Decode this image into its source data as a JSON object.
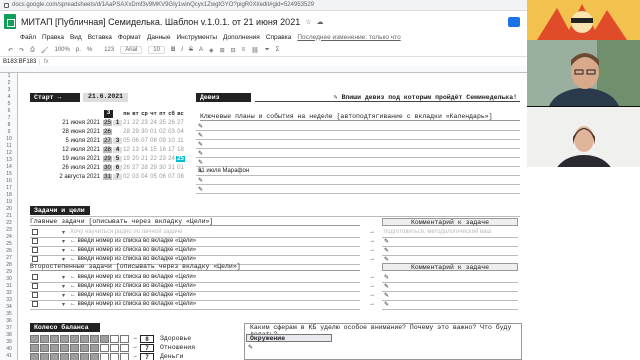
{
  "browser": {
    "url": "docs.google.com/spreadsheets/d/1AaPSAXxDmf3v9MKV9GIy1winQcyx1ZwgtGYO?pigR0Xl/edit#gid=524953529"
  },
  "sheet": {
    "title": "МИТАП [Публичная] Семиделька. Шаблон v.1.0.1. от 21 июня 2021",
    "menu": [
      "Файл",
      "Правка",
      "Вид",
      "Вставка",
      "Формат",
      "Данные",
      "Инструменты",
      "Дополнения",
      "Справка"
    ],
    "last_edit": "Последнее изменение: только что",
    "toolbar": {
      "zoom": "100%",
      "currency": "р.",
      "pct": "%",
      ".0": ".0",
      ".00": ".00",
      "fmt": "123",
      "font": "Arial",
      "size": "10"
    },
    "cell_ref": "B183:BF183"
  },
  "planner": {
    "start_label": "Старт →",
    "start_date": "21.6.2021",
    "motto_label": "Девиз",
    "motto_text": "✎ Впиши девиз под которым пройдёт Семинеделька!",
    "week_num": "3",
    "days": [
      "пн",
      "вт",
      "ср",
      "чт",
      "пт",
      "сб",
      "вс"
    ],
    "weeks": [
      {
        "date": "21 июня 2021",
        "num": "25",
        "mark": "1",
        "days": [
          "21",
          "22",
          "23",
          "24",
          "25",
          "26",
          "27"
        ]
      },
      {
        "date": "28 июня 2021",
        "num": "26",
        "mark": "",
        "days": [
          "28",
          "29",
          "30",
          "01",
          "02",
          "03",
          "04"
        ]
      },
      {
        "date": "5 июля 2021",
        "num": "27",
        "mark": "3",
        "days": [
          "05",
          "06",
          "07",
          "08",
          "09",
          "10",
          "11"
        ]
      },
      {
        "date": "12 июля 2021",
        "num": "28",
        "mark": "4",
        "days": [
          "12",
          "13",
          "14",
          "15",
          "16",
          "17",
          "18"
        ]
      },
      {
        "date": "19 июля 2021",
        "num": "29",
        "mark": "5",
        "days": [
          "19",
          "20",
          "21",
          "22",
          "23",
          "24",
          "25"
        ]
      },
      {
        "date": "26 июля 2021",
        "num": "30",
        "mark": "6",
        "days": [
          "26",
          "27",
          "28",
          "29",
          "30",
          "31",
          "01"
        ]
      },
      {
        "date": "2 августа 2021",
        "num": "31",
        "mark": "7",
        "days": [
          "02",
          "03",
          "04",
          "05",
          "06",
          "07",
          "08"
        ]
      }
    ],
    "events_header": "Ключевые планы и события на неделе [автоподтягивание с вкладки «Календарь»]",
    "event_note": "31 июля Марафон",
    "goals_block": "Задачи и цели",
    "main_tasks": "Главные задачи [описывать через вкладку «Цели»]",
    "comment": "Комментарий к задаче",
    "sub_tasks": "Второстепенные задачи [описывать через вкладку «Цели»]",
    "hint": "← введи номер из списка во вкладке «Цели»",
    "ghost_hint": "Хочу научиться радио по личной задаче",
    "ghost_comment": "подготовиться, методологический ваш",
    "wheel_block": "Колесо баланса",
    "wheel_items": [
      {
        "num": "8",
        "label": "Здоровье"
      },
      {
        "num": "7",
        "label": "Отношения"
      },
      {
        "num": "7",
        "label": "Деньги"
      }
    ],
    "focus_question": "Каким сферам в КБ уделю особое внимание? Почему это важно? Что буду делать?",
    "focus_select": "Окружение",
    "pencil": "✎",
    "arrow": "→"
  },
  "colors": {
    "accent": "#00bcd4",
    "dark": "#222222",
    "shade": "#bdbdbd"
  }
}
